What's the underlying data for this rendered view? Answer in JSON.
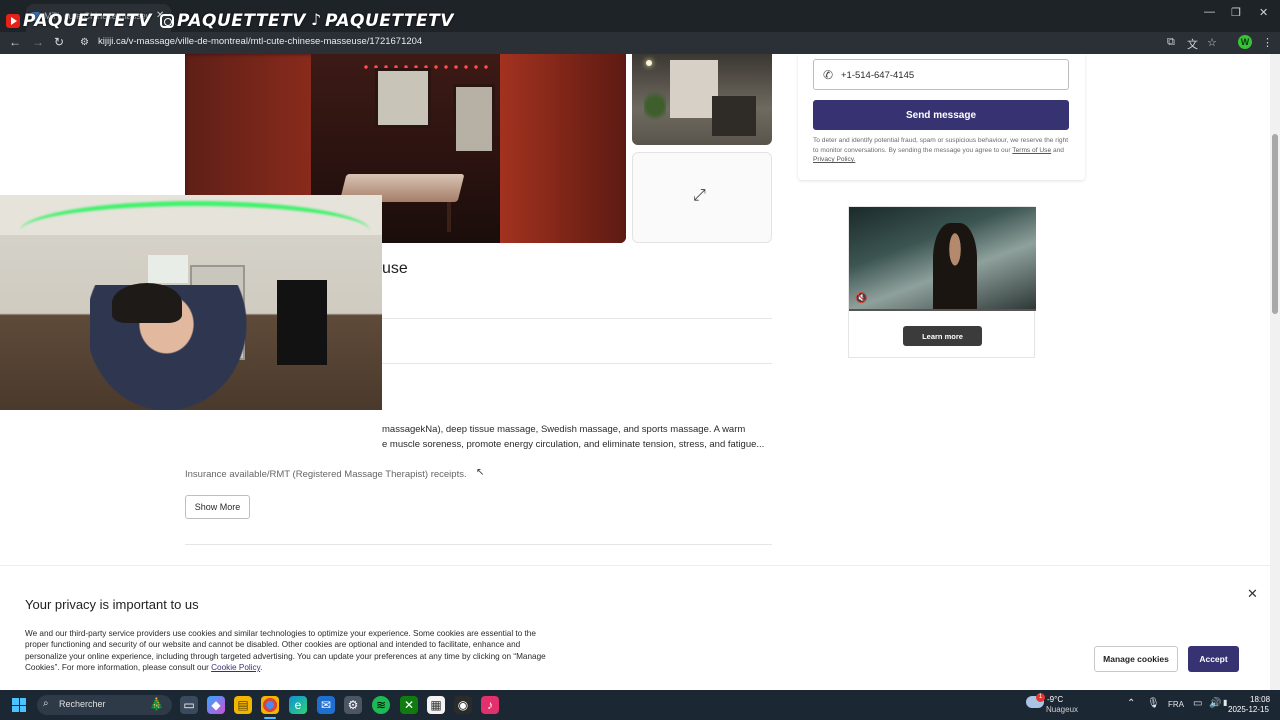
{
  "browser": {
    "tab_title": "MTL cute Chinese masseuse | ...",
    "url_host": "kijiji.ca",
    "url_path": "/v-massage/ville-de-montreal/mtl-cute-chinese-masseuse/1721671204"
  },
  "stream_overlay": {
    "handles": [
      "PAQUETTETV",
      "PAQUETTETV",
      "PAQUETTETV"
    ],
    "icons": [
      "youtube-icon",
      "instagram-icon",
      "tiktok-icon"
    ]
  },
  "listing": {
    "title_visible_tail": "use",
    "description_lines": [
      "massagekNa), deep tissue massage, Swedish massage, and sports massage. A warm",
      "e muscle soreness, promote energy circulation, and eliminate tension, stress, and fatigue...",
      "Insurance available/RMT (Registered Massage Therapist) receipts."
    ],
    "show_more_label": "Show More"
  },
  "contact": {
    "phone_value": "+1-514-647-4145",
    "send_label": "Send message",
    "disclaimer_text": "To deter and identify potential fraud, spam or suspicious behaviour, we reserve the right to monitor conversations. By sending the message you agree to our",
    "terms_label": "Terms of Use",
    "and_label": "and",
    "privacy_label": "Privacy Policy."
  },
  "ad": {
    "learn_more_label": "Learn more"
  },
  "cookie_banner": {
    "title": "Your privacy is important to us",
    "body": "We and our third-party service providers use cookies and similar technologies to optimize your experience. Some cookies are essential to the proper functioning and security of our website and cannot be disabled. Other cookies are optional and intended to facilitate, enhance and personalize your online experience, including through targeted advertising. You can update your preferences at any time by clicking on “Manage Cookies”. For more information, please consult our",
    "policy_link": "Cookie Policy",
    "manage_label": "Manage cookies",
    "accept_label": "Accept"
  },
  "taskbar": {
    "search_placeholder": "Rechercher",
    "weather_temp": "-9°C",
    "weather_desc": "Nuageux",
    "weather_badge": "1",
    "language": "FRA",
    "time": "18:08",
    "date": "2025-12-15",
    "profile_initial": "W"
  },
  "colors": {
    "brand_primary": "#373373",
    "browser_bg": "#1e2328",
    "taskbar_bg": "#1c2734"
  }
}
